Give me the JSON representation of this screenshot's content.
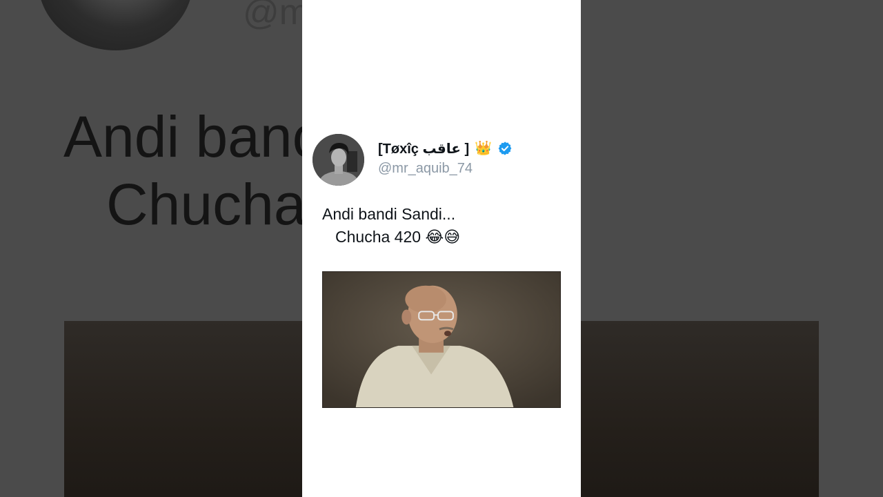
{
  "tweet": {
    "display_name": "[Tøxîç عاقب ]",
    "crown_emoji": "👑",
    "handle": "@mr_aquib_74",
    "text_line1": "Andi bandi Sandi...",
    "text_line2": "Chucha 420 😂😅",
    "verified": true,
    "avatar_icon": "profile-photo",
    "media_icon": "video-still-man-speaking"
  },
  "background": {
    "handle_fragment": "@m",
    "line1_fragment": "Andi banc",
    "line2_fragment": "Chucha"
  },
  "colors": {
    "verified_blue": "#1d9bf0",
    "text_primary": "#0f1419",
    "text_secondary": "#8b98a5"
  }
}
